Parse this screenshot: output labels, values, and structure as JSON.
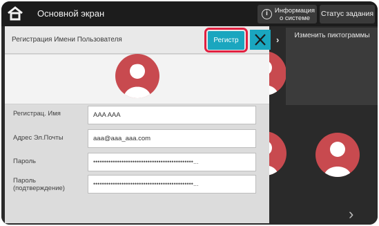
{
  "topbar": {
    "title": "Основной экран",
    "system_info_label": "Информация о системе",
    "job_status_label": "Статус задания",
    "home_icon": "home-icon",
    "info_icon": "info-icon",
    "info_glyph": "i"
  },
  "background": {
    "change_icons_label": "Изменить пиктограммы",
    "panel_chevron": "›",
    "bottom_chevron": "›"
  },
  "dialog": {
    "title": "Регистрация Имени Пользователя",
    "register_label": "Регистр",
    "close_icon": "close-icon",
    "avatar_icon": "user-avatar-icon",
    "fields": [
      {
        "label": "Регистрац. Имя",
        "value": "AAA AAA"
      },
      {
        "label": "Адрес Эл.Почты",
        "value": "aaa@aaa_aaa.com"
      },
      {
        "label": "Пароль",
        "value": "••••••••••••••••••••••••••••••••••••••••••••••..."
      },
      {
        "label": "Пароль (подтверждение)",
        "value": "••••••••••••••••••••••••••••••••••••••••••••••..."
      }
    ]
  },
  "colors": {
    "accent": "#1aa6bf",
    "highlight_ring": "#e21f3f",
    "avatar_red": "#c84a4f"
  }
}
